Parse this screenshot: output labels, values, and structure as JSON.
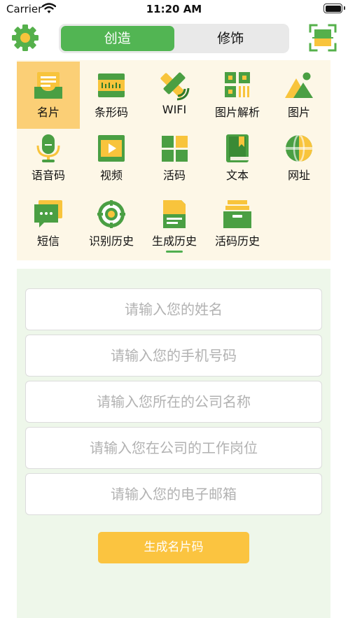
{
  "status_bar": {
    "carrier": "Carrier",
    "time": "11:20 AM"
  },
  "nav": {
    "settings_icon": "gear-icon",
    "scan_icon": "scan-frame-icon",
    "segments": [
      {
        "label": "创造",
        "active": true
      },
      {
        "label": "修饰",
        "active": false
      }
    ]
  },
  "grid": {
    "items": [
      {
        "label": "名片",
        "icon": "business-card-icon",
        "selected": true
      },
      {
        "label": "条形码",
        "icon": "barcode-icon"
      },
      {
        "label": "WIFI",
        "icon": "wifi-icon"
      },
      {
        "label": "图片解析",
        "icon": "qr-parse-icon"
      },
      {
        "label": "图片",
        "icon": "image-icon"
      },
      {
        "label": "语音码",
        "icon": "microphone-icon"
      },
      {
        "label": "视频",
        "icon": "video-icon"
      },
      {
        "label": "活码",
        "icon": "tiles-icon"
      },
      {
        "label": "文本",
        "icon": "book-icon"
      },
      {
        "label": "网址",
        "icon": "globe-icon"
      },
      {
        "label": "短信",
        "icon": "sms-icon"
      },
      {
        "label": "识别历史",
        "icon": "scan-history-icon"
      },
      {
        "label": "生成历史",
        "icon": "document-history-icon"
      },
      {
        "label": "活码历史",
        "icon": "archive-icon"
      }
    ]
  },
  "form": {
    "name_placeholder": "请输入您的姓名",
    "phone_placeholder": "请输入您的手机号码",
    "company_placeholder": "请输入您所在的公司名称",
    "position_placeholder": "请输入您在公司的工作岗位",
    "email_placeholder": "请输入您的电子邮箱",
    "submit_label": "生成名片码"
  },
  "colors": {
    "green": "#52b553",
    "yellow": "#fbc440",
    "grid_bg": "#fdf7e7",
    "form_bg": "#eef7ea",
    "selected_bg": "#fbcf76"
  }
}
